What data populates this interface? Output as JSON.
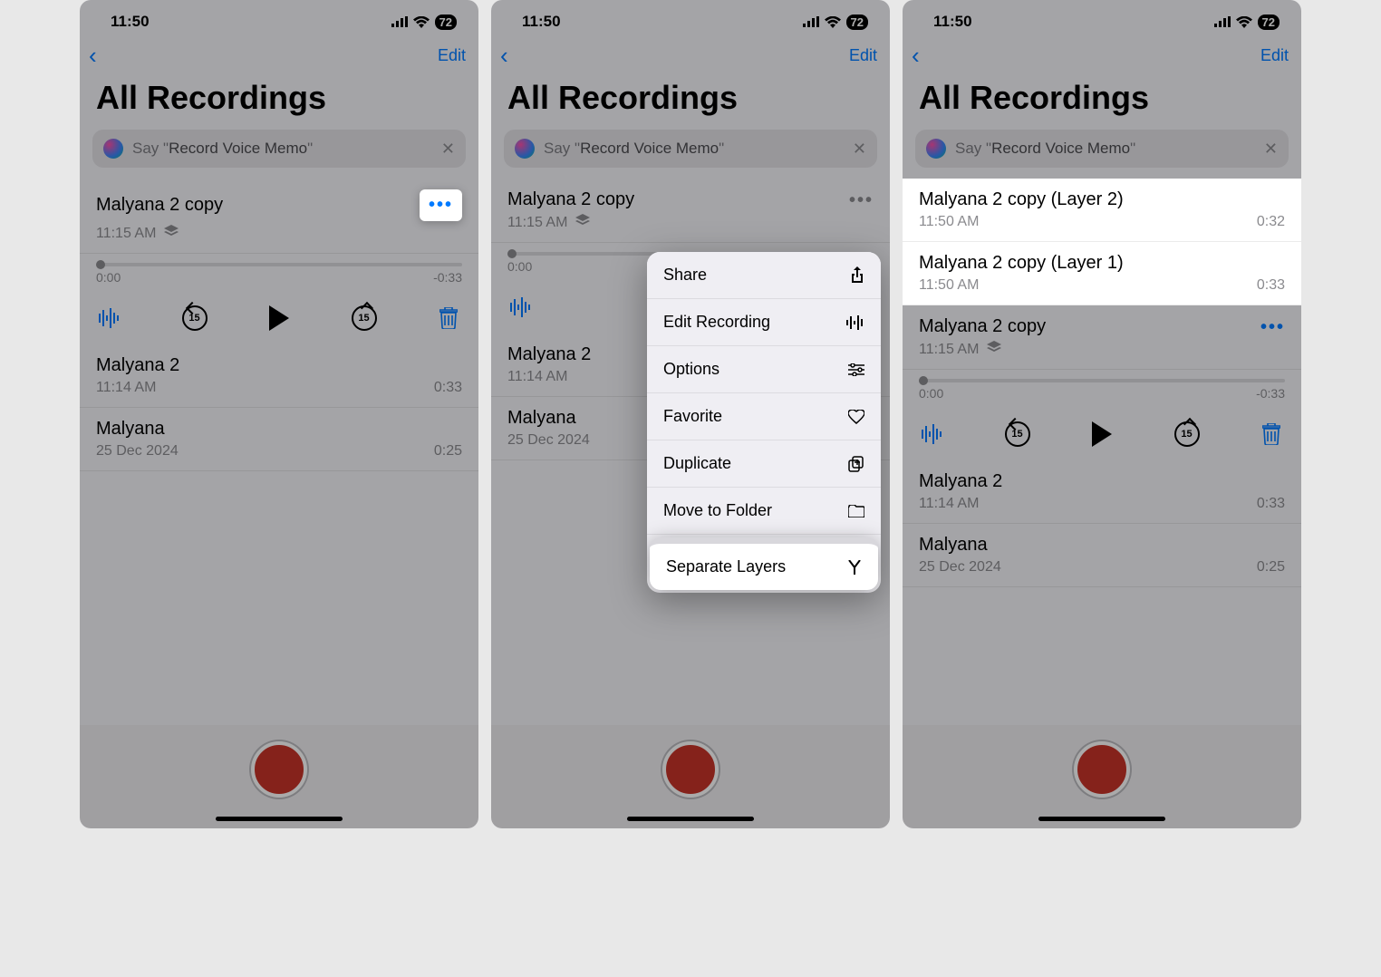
{
  "status": {
    "time": "11:50",
    "battery": "72"
  },
  "nav": {
    "edit": "Edit"
  },
  "title": "All Recordings",
  "siri": {
    "say": "Say \"",
    "cmd": "Record Voice Memo",
    "end": "\""
  },
  "player": {
    "tStart": "0:00",
    "tEnd": "-0:33"
  },
  "screen1": {
    "rec1": {
      "title": "Malyana 2 copy",
      "time": "11:15 AM"
    },
    "rec2": {
      "title": "Malyana 2",
      "time": "11:14 AM",
      "dur": "0:33"
    },
    "rec3": {
      "title": "Malyana",
      "time": "25 Dec 2024",
      "dur": "0:25"
    }
  },
  "screen2": {
    "rec1": {
      "title": "Malyana 2 copy",
      "time": "11:15 AM"
    },
    "rec2": {
      "title": "Malyana 2",
      "time": "11:14 AM"
    },
    "rec3": {
      "title": "Malyana",
      "time": "25 Dec 2024"
    },
    "menu": {
      "share": "Share",
      "edit": "Edit Recording",
      "options": "Options",
      "favorite": "Favorite",
      "duplicate": "Duplicate",
      "move": "Move to Folder",
      "separate": "Separate Layers"
    }
  },
  "screen3": {
    "l2": {
      "title": "Malyana 2 copy (Layer 2)",
      "time": "11:50 AM",
      "dur": "0:32"
    },
    "l1": {
      "title": "Malyana 2 copy (Layer 1)",
      "time": "11:50 AM",
      "dur": "0:33"
    },
    "rec1": {
      "title": "Malyana 2 copy",
      "time": "11:15 AM"
    },
    "rec2": {
      "title": "Malyana 2",
      "time": "11:14 AM",
      "dur": "0:33"
    },
    "rec3": {
      "title": "Malyana",
      "time": "25 Dec 2024",
      "dur": "0:25"
    }
  },
  "skip": "15"
}
